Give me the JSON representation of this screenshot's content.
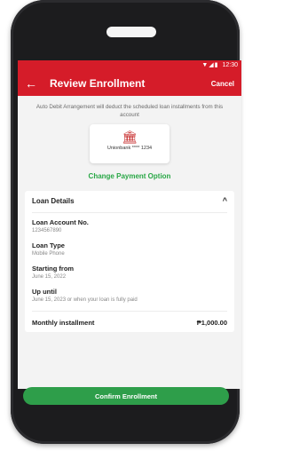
{
  "status_bar": {
    "time": "12:30"
  },
  "header": {
    "title": "Review Enrollment",
    "cancel_label": "Cancel"
  },
  "payment": {
    "info_text": "Auto Debit Arrangement will deduct the scheduled loan installments from this account",
    "bank_label": "Unionbank **** 1234",
    "change_label": "Change Payment Option"
  },
  "loan_details": {
    "title": "Loan Details",
    "fields": [
      {
        "label": "Loan Account No.",
        "value": "1234567890"
      },
      {
        "label": "Loan Type",
        "value": "Mobile Phone"
      },
      {
        "label": "Starting from",
        "value": "June 15, 2022"
      },
      {
        "label": "Up until",
        "value": "June 15, 2023 or when your loan is fully paid"
      }
    ],
    "monthly_label": "Monthly installment",
    "monthly_value": "₱1,000.00"
  },
  "confirm_label": "Confirm Enrollment",
  "colors": {
    "primary": "#d51c29",
    "accent": "#2e9e4a"
  }
}
